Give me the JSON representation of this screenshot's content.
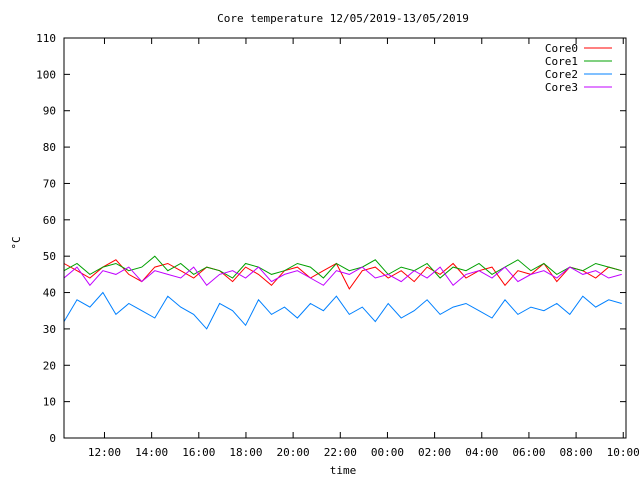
{
  "chart_data": {
    "type": "line",
    "title": "Core temperature 12/05/2019-13/05/2019",
    "xlabel": "time",
    "ylabel": "°C",
    "ylim": [
      0,
      110
    ],
    "yticks": [
      0,
      10,
      20,
      30,
      40,
      50,
      60,
      70,
      80,
      90,
      100,
      110
    ],
    "xlim": [
      "2019-05-12 10:17",
      "2019-05-13 10:07"
    ],
    "xticks": [
      {
        "time": "2019-05-12 12:00",
        "label": "12:00"
      },
      {
        "time": "2019-05-12 14:00",
        "label": "14:00"
      },
      {
        "time": "2019-05-12 16:00",
        "label": "16:00"
      },
      {
        "time": "2019-05-12 18:00",
        "label": "18:00"
      },
      {
        "time": "2019-05-12 20:00",
        "label": "20:00"
      },
      {
        "time": "2019-05-12 22:00",
        "label": "22:00"
      },
      {
        "time": "2019-05-13 00:00",
        "label": "00:00"
      },
      {
        "time": "2019-05-13 02:00",
        "label": "02:00"
      },
      {
        "time": "2019-05-13 04:00",
        "label": "04:00"
      },
      {
        "time": "2019-05-13 06:00",
        "label": "06:00"
      },
      {
        "time": "2019-05-13 08:00",
        "label": "08:00"
      },
      {
        "time": "2019-05-13 10:00",
        "label": "10:00"
      }
    ],
    "grid": false,
    "legend_position": "top-right",
    "x": [
      "2019-05-12 10:17",
      "2019-05-12 10:50",
      "2019-05-12 11:23",
      "2019-05-12 11:56",
      "2019-05-12 12:29",
      "2019-05-12 13:02",
      "2019-05-12 13:35",
      "2019-05-12 14:08",
      "2019-05-12 14:41",
      "2019-05-12 15:14",
      "2019-05-12 15:47",
      "2019-05-12 16:20",
      "2019-05-12 16:53",
      "2019-05-12 17:26",
      "2019-05-12 17:59",
      "2019-05-12 18:32",
      "2019-05-12 19:05",
      "2019-05-12 19:38",
      "2019-05-12 20:11",
      "2019-05-12 20:44",
      "2019-05-12 21:17",
      "2019-05-12 21:50",
      "2019-05-12 22:23",
      "2019-05-12 22:56",
      "2019-05-12 23:29",
      "2019-05-13 00:02",
      "2019-05-13 00:35",
      "2019-05-13 01:08",
      "2019-05-13 01:41",
      "2019-05-13 02:14",
      "2019-05-13 02:47",
      "2019-05-13 03:20",
      "2019-05-13 03:53",
      "2019-05-13 04:26",
      "2019-05-13 04:59",
      "2019-05-13 05:32",
      "2019-05-13 06:05",
      "2019-05-13 06:38",
      "2019-05-13 07:11",
      "2019-05-13 07:44",
      "2019-05-13 08:17",
      "2019-05-13 08:50",
      "2019-05-13 09:23",
      "2019-05-13 09:56"
    ],
    "series": [
      {
        "name": "Core0",
        "color": "#ff0000",
        "values": [
          48,
          46,
          44,
          47,
          49,
          45,
          43,
          47,
          48,
          46,
          44,
          47,
          46,
          43,
          47,
          45,
          42,
          46,
          47,
          44,
          46,
          48,
          41,
          46,
          47,
          44,
          46,
          43,
          47,
          45,
          48,
          44,
          46,
          47,
          42,
          46,
          45,
          48,
          43,
          47,
          46,
          44,
          47,
          46
        ]
      },
      {
        "name": "Core1",
        "color": "#00a000",
        "values": [
          46,
          48,
          45,
          47,
          48,
          46,
          47,
          50,
          46,
          48,
          45,
          47,
          46,
          44,
          48,
          47,
          45,
          46,
          48,
          47,
          44,
          48,
          46,
          47,
          49,
          45,
          47,
          46,
          48,
          44,
          47,
          46,
          48,
          45,
          47,
          49,
          46,
          48,
          45,
          47,
          46,
          48,
          47,
          46
        ]
      },
      {
        "name": "Core2",
        "color": "#0080ff",
        "values": [
          32,
          38,
          36,
          40,
          34,
          37,
          35,
          33,
          39,
          36,
          34,
          30,
          37,
          35,
          31,
          38,
          34,
          36,
          33,
          37,
          35,
          39,
          34,
          36,
          32,
          37,
          33,
          35,
          38,
          34,
          36,
          37,
          35,
          33,
          38,
          34,
          36,
          35,
          37,
          34,
          39,
          36,
          38,
          37
        ]
      },
      {
        "name": "Core3",
        "color": "#c000ff",
        "values": [
          44,
          47,
          42,
          46,
          45,
          47,
          43,
          46,
          45,
          44,
          47,
          42,
          45,
          46,
          44,
          47,
          43,
          45,
          46,
          44,
          42,
          46,
          45,
          47,
          44,
          45,
          43,
          46,
          44,
          47,
          42,
          45,
          46,
          44,
          47,
          43,
          45,
          46,
          44,
          47,
          45,
          46,
          44,
          45
        ]
      }
    ]
  }
}
